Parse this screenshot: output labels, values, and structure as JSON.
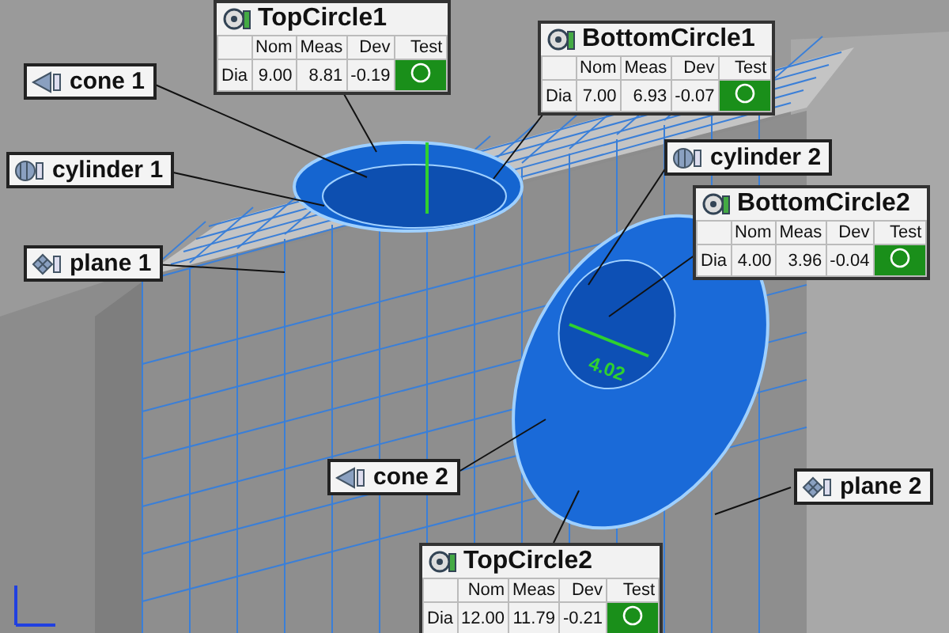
{
  "viewport": {
    "dimension": "4.02",
    "features": [
      {
        "kind": "cone",
        "label": "cone 1"
      },
      {
        "kind": "cylinder",
        "label": "cylinder 1"
      },
      {
        "kind": "plane",
        "label": "plane 1"
      },
      {
        "kind": "cylinder",
        "label": "cylinder 2"
      },
      {
        "kind": "cone",
        "label": "cone 2"
      },
      {
        "kind": "plane",
        "label": "plane 2"
      }
    ],
    "measurements": [
      {
        "title": "TopCircle1",
        "columns": [
          "Nom",
          "Meas",
          "Dev",
          "Test"
        ],
        "row": {
          "name": "Dia",
          "nom": "9.00",
          "meas": "8.81",
          "dev": "-0.19",
          "passed": true
        }
      },
      {
        "title": "BottomCircle1",
        "columns": [
          "Nom",
          "Meas",
          "Dev",
          "Test"
        ],
        "row": {
          "name": "Dia",
          "nom": "7.00",
          "meas": "6.93",
          "dev": "-0.07",
          "passed": true
        }
      },
      {
        "title": "BottomCircle2",
        "columns": [
          "Nom",
          "Meas",
          "Dev",
          "Test"
        ],
        "row": {
          "name": "Dia",
          "nom": "4.00",
          "meas": "3.96",
          "dev": "-0.04",
          "passed": true
        }
      },
      {
        "title": "TopCircle2",
        "columns": [
          "Nom",
          "Meas",
          "Dev",
          "Test"
        ],
        "row": {
          "name": "Dia",
          "nom": "12.00",
          "meas": "11.79",
          "dev": "-0.21",
          "passed": true
        }
      }
    ]
  }
}
